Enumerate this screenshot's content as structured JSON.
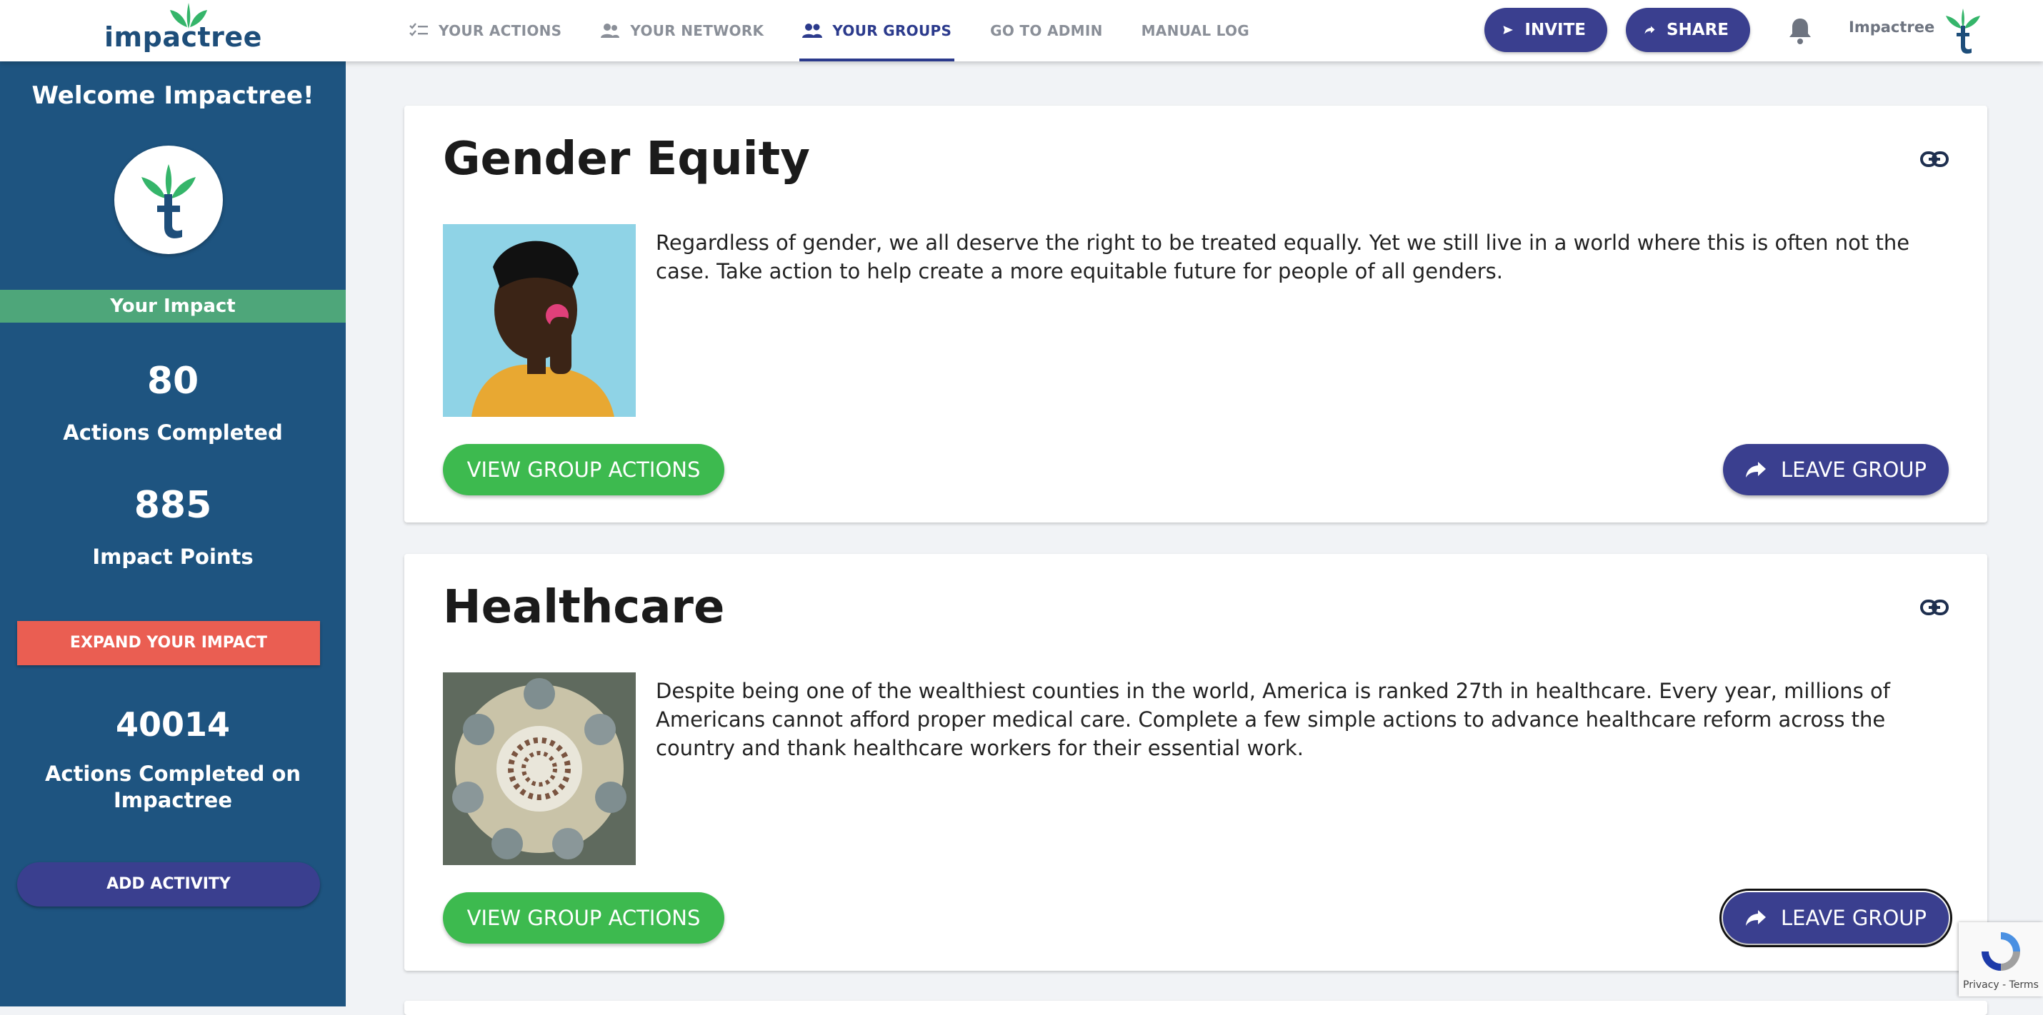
{
  "brand": {
    "name": "impactree"
  },
  "nav": {
    "items": [
      {
        "label": "YOUR ACTIONS",
        "icon": "checklist-icon"
      },
      {
        "label": "YOUR NETWORK",
        "icon": "people-icon"
      },
      {
        "label": "YOUR GROUPS",
        "icon": "groups-icon",
        "active": true
      },
      {
        "label": "GO TO ADMIN"
      },
      {
        "label": "MANUAL LOG"
      }
    ]
  },
  "header": {
    "invite_label": "INVITE",
    "share_label": "SHARE",
    "user_name": "Impactree"
  },
  "sidebar": {
    "welcome": "Welcome Impactree!",
    "impact_header": "Your Impact",
    "actions_completed": "80",
    "actions_completed_label": "Actions Completed",
    "impact_points": "885",
    "impact_points_label": "Impact Points",
    "expand_label": "EXPAND YOUR IMPACT",
    "platform_actions": "40014",
    "platform_actions_label": "Actions Completed on Impactree",
    "add_activity_label": "ADD ACTIVITY"
  },
  "groups": [
    {
      "title": "Gender Equity",
      "description": "Regardless of gender, we all deserve the right to be treated equally. Yet we still live in a world where this is often not the case. Take action to help create a more equitable future for people of all genders.",
      "view_label": "VIEW GROUP ACTIONS",
      "leave_label": "LEAVE GROUP"
    },
    {
      "title": "Healthcare",
      "description": "Despite being one of the wealthiest counties in the world, America is ranked 27th in healthcare. Every year, millions of Americans cannot afford proper medical care. Complete a few simple actions to advance healthcare reform across the country and thank healthcare workers for their essential work.",
      "view_label": "VIEW GROUP ACTIONS",
      "leave_label": "LEAVE GROUP"
    }
  ],
  "recaptcha": {
    "text": "Privacy - Terms"
  },
  "colors": {
    "sidebar": "#1e5480",
    "accent": "#3a3f8f",
    "green": "#3dba4f",
    "impact_bar": "#4ea67a",
    "expand": "#ea5e52"
  }
}
